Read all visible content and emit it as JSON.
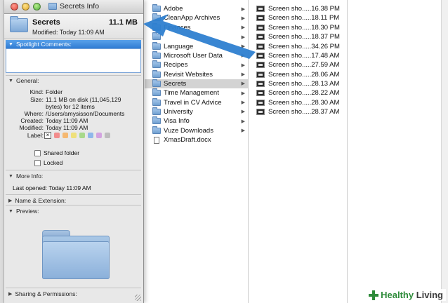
{
  "finder": {
    "column1": [
      {
        "name": "Adobe",
        "type": "folder",
        "selected": false
      },
      {
        "name": "CleanApp Archives",
        "type": "folder",
        "selected": false
      },
      {
        "name": "Finances",
        "type": "folder",
        "selected": false
      },
      {
        "name": "",
        "type": "folder",
        "selected": false
      },
      {
        "name": "Language",
        "type": "folder",
        "selected": false
      },
      {
        "name": "Microsoft User Data",
        "type": "folder",
        "selected": false
      },
      {
        "name": "Recipes",
        "type": "folder",
        "selected": false
      },
      {
        "name": "Revisit Websites",
        "type": "folder",
        "selected": false
      },
      {
        "name": "Secrets",
        "type": "folder",
        "selected": true
      },
      {
        "name": "Time Management",
        "type": "folder",
        "selected": false
      },
      {
        "name": "Travel in CV Advice",
        "type": "folder",
        "selected": false
      },
      {
        "name": "University",
        "type": "folder",
        "selected": false
      },
      {
        "name": "Visa Info",
        "type": "folder",
        "selected": false
      },
      {
        "name": "Vuze Downloads",
        "type": "folder",
        "selected": false
      },
      {
        "name": "XmasDraft.docx",
        "type": "doc",
        "selected": false
      }
    ],
    "column2": [
      "Screen sho.....16.38 PM",
      "Screen sho.....18.11 PM",
      "Screen sho.....18.30 PM",
      "Screen sho.....18.37 PM",
      "Screen sho.....34.26 PM",
      "Screen sho.....17.48 AM",
      "Screen sho.....27.59 AM",
      "Screen sho.....28.06 AM",
      "Screen sho.....28.13 AM",
      "Screen sho.....28.22 AM",
      "Screen sho.....28.30 AM",
      "Screen sho.....28.37 AM"
    ]
  },
  "info": {
    "window_title": "Secrets Info",
    "name": "Secrets",
    "size": "11.1 MB",
    "modified_line": "Modified: Today 11:09 AM",
    "spotlight_label": "Spotlight Comments:",
    "general_label": "General:",
    "general": {
      "kind_k": "Kind:",
      "kind_v": "Folder",
      "size_k": "Size:",
      "size_v1": "11.1 MB on disk (11,045,129",
      "size_v2": "bytes) for 12 items",
      "where_k": "Where:",
      "where_v": "/Users/amysisson/Documents",
      "created_k": "Created:",
      "created_v": "Today 11:09 AM",
      "modified_k": "Modified:",
      "modified_v": "Today 11:09 AM",
      "label_k": "Label:"
    },
    "label_colors": [
      "#f28c8c",
      "#f5b870",
      "#efe07a",
      "#a8d98b",
      "#8fb7ea",
      "#d3a3e0",
      "#bdbdbd"
    ],
    "shared_folder": "Shared folder",
    "locked": "Locked",
    "more_info_label": "More Info:",
    "last_opened": "Last opened: Today 11:09 AM",
    "name_ext_label": "Name & Extension:",
    "preview_label": "Preview:",
    "sharing_label": "Sharing & Permissions:"
  },
  "watermark": {
    "part1": "Healthy",
    "part2": " Living"
  },
  "colors": {
    "arrow": "#2e7fd0",
    "selection": "#d3d3d3",
    "spotlight_bar": "#3a86d8"
  }
}
